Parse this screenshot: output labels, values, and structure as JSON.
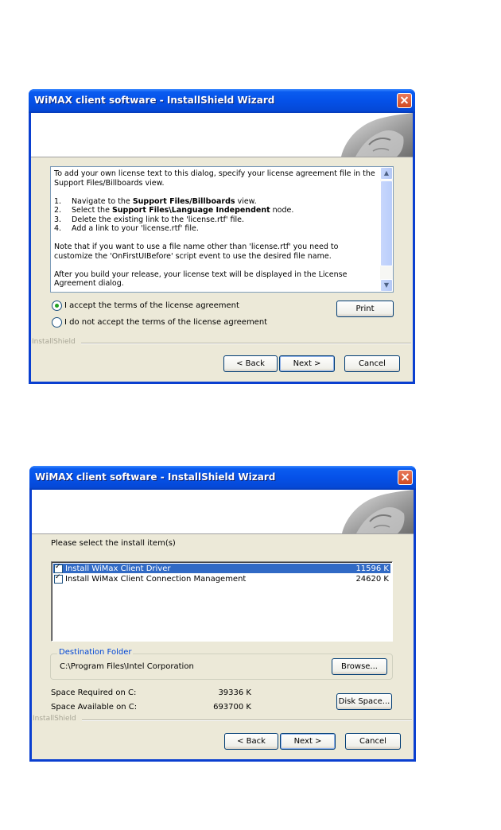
{
  "dialog1": {
    "title": "WiMAX client software - InstallShield Wizard",
    "license_lines": {
      "p1": "To add your own license text to this dialog, specify your license agreement file in the Support Files/Billboards view.",
      "s1_num": "1.",
      "s1_a": "Navigate to the ",
      "s1_b": "Support Files/Billboards",
      "s1_c": " view.",
      "s2_num": "2.",
      "s2_a": "Select the ",
      "s2_b": "Support Files\\Language Independent",
      "s2_c": " node.",
      "s3_num": "3.",
      "s3": "Delete the existing link to the 'license.rtf' file.",
      "s4_num": "4.",
      "s4": "Add a link to your 'license.rtf' file.",
      "p2": "Note that if you want to use a file name other than 'license.rtf' you need to customize the 'OnFirstUIBefore' script event to use the desired file name.",
      "p3": "After you build your release, your license text will be displayed in the License Agreement dialog."
    },
    "radio_accept": "I accept the terms of the license agreement",
    "radio_decline": "I do not accept the terms of the license agreement",
    "print_label": "Print",
    "installshield_label": "InstallShield",
    "back_label": "< Back",
    "next_label": "Next >",
    "cancel_label": "Cancel"
  },
  "dialog2": {
    "title": "WiMAX client software - InstallShield Wizard",
    "prompt": "Please select the install item(s)",
    "items": [
      {
        "label": "Install WiMax Client Driver",
        "size": "11596 K",
        "checked": true
      },
      {
        "label": "Install WiMax Client Connection Management",
        "size": "24620 K",
        "checked": true
      }
    ],
    "destination_legend": "Destination Folder",
    "destination_path": "C:\\Program Files\\Intel Corporation",
    "browse_label": "Browse...",
    "space_required_label": "Space Required on  C:",
    "space_required_value": "39336 K",
    "space_available_label": "Space Available on  C:",
    "space_available_value": "693700 K",
    "disk_space_label": "Disk Space...",
    "installshield_label": "InstallShield",
    "back_label": "< Back",
    "next_label": "Next >",
    "cancel_label": "Cancel"
  },
  "colors": {
    "titlebar": "#0551e8",
    "dialog_bg": "#ece9d8",
    "selection": "#316ac5",
    "group_legend": "#0046d5"
  },
  "icons": [
    "close-icon",
    "scroll-up-icon",
    "scroll-down-icon",
    "checkbox-checked-icon",
    "radio-icon",
    "banner-face-graphic"
  ]
}
